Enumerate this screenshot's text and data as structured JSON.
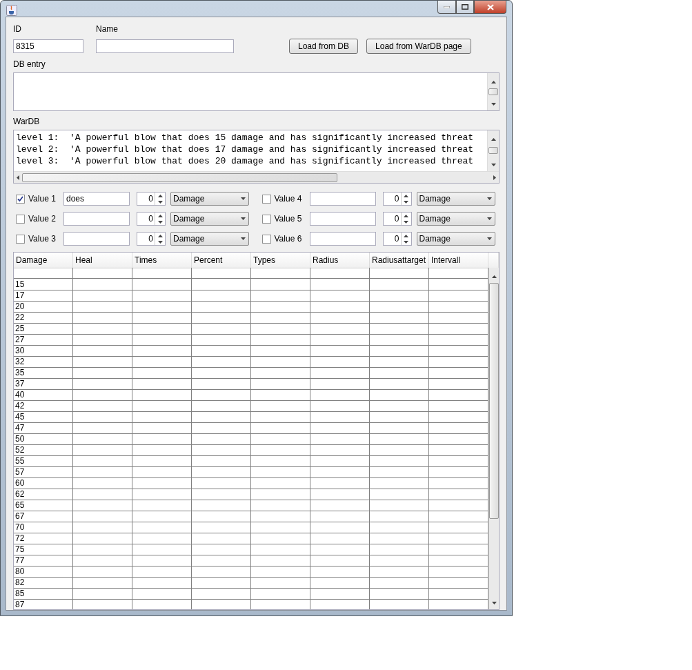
{
  "form": {
    "id_label": "ID",
    "id_value": "8315",
    "name_label": "Name",
    "buttons": [
      "Load from DB",
      "Load from WarDB page"
    ]
  },
  "db_entry": {
    "label": "DB entry"
  },
  "wardb": {
    "label": "WarDB",
    "lines": [
      "level 1:  'A powerful blow that does 15 damage and has significantly increased threat",
      "level 2:  'A powerful blow that does 17 damage and has significantly increased threat",
      "level 3:  'A powerful blow that does 20 damage and has significantly increased threat"
    ]
  },
  "values": [
    {
      "label": "Value 1",
      "checked": true,
      "text": "does",
      "spinner": "0",
      "type": "Damage"
    },
    {
      "label": "Value 2",
      "checked": false,
      "spinner": "0",
      "type": "Damage"
    },
    {
      "label": "Value 3",
      "checked": false,
      "spinner": "0",
      "type": "Damage"
    },
    {
      "label": "Value 4",
      "checked": false,
      "spinner": "0",
      "type": "Damage"
    },
    {
      "label": "Value 5",
      "checked": false,
      "spinner": "0",
      "type": "Damage"
    },
    {
      "label": "Value 6",
      "checked": false,
      "spinner": "0",
      "type": "Damage"
    }
  ],
  "table": {
    "columns": [
      "Damage",
      "Heal",
      "Times",
      "Percent",
      "Types",
      "Radius",
      "Radiusattarget",
      "Intervall"
    ],
    "rows": [
      "15",
      "17",
      "20",
      "22",
      "25",
      "27",
      "30",
      "32",
      "35",
      "37",
      "40",
      "42",
      "45",
      "47",
      "50",
      "52",
      "55",
      "57",
      "60",
      "62",
      "65",
      "67",
      "70",
      "72",
      "75",
      "77",
      "80",
      "82",
      "85",
      "87"
    ]
  }
}
